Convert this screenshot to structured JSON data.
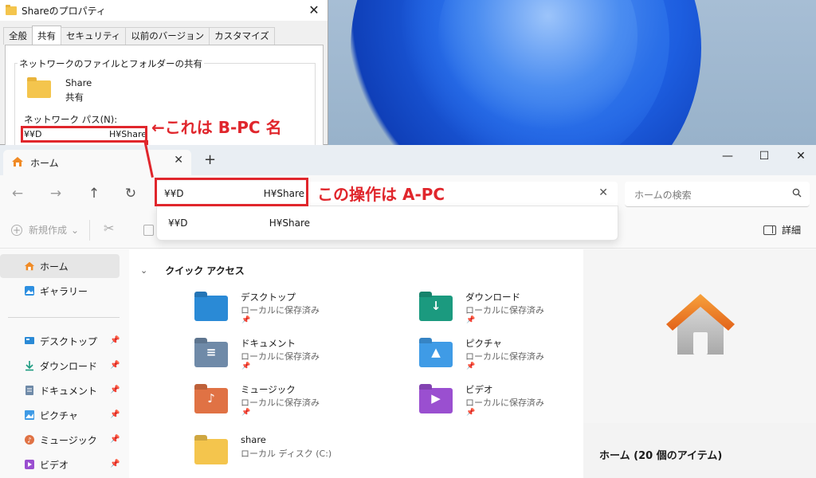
{
  "properties_dialog": {
    "title": "Shareのプロパティ",
    "close_glyph": "✕",
    "tabs": [
      "全般",
      "共有",
      "セキュリティ",
      "以前のバージョン",
      "カスタマイズ"
    ],
    "active_tab": 1,
    "group_label": "ネットワークのファイルとフォルダーの共有",
    "share_name": "Share",
    "share_state": "共有",
    "network_path_label": "ネットワーク パス(N):",
    "network_path_start": "¥¥D",
    "network_path_end": "H¥Share"
  },
  "annotations": {
    "b_pc": "←これは B-PC 名",
    "a_pc": "この操作は A-PC",
    "color": "#e0262c"
  },
  "explorer": {
    "tab_label": "ホーム",
    "tab_close": "✕",
    "new_tab": "+",
    "window_controls": [
      "—",
      "☐",
      "✕"
    ],
    "nav": {
      "back": "←",
      "forward": "→",
      "up": "↑",
      "refresh": "↻"
    },
    "address_start": "¥¥D",
    "address_end": "H¥Share",
    "address_clear": "✕",
    "suggestion_start": "¥¥D",
    "suggestion_end": "H¥Share",
    "search_placeholder": "ホームの検索",
    "toolbar": {
      "new_label": "新規作成",
      "new_chevron": "⌄",
      "detail_label": "詳細"
    },
    "sidebar": [
      {
        "label": "ホーム",
        "icon": "home-icon",
        "pinned": false
      },
      {
        "label": "ギャラリー",
        "icon": "gallery-icon",
        "pinned": false
      },
      {
        "label": "デスクトップ",
        "icon": "desktop-icon",
        "pinned": true
      },
      {
        "label": "ダウンロード",
        "icon": "download-icon",
        "pinned": true
      },
      {
        "label": "ドキュメント",
        "icon": "document-icon",
        "pinned": true
      },
      {
        "label": "ピクチャ",
        "icon": "picture-icon",
        "pinned": true
      },
      {
        "label": "ミュージック",
        "icon": "music-icon",
        "pinned": true
      },
      {
        "label": "ビデオ",
        "icon": "video-icon",
        "pinned": true
      }
    ],
    "quick_access_title": "クイック アクセス",
    "quick_access": [
      {
        "name": "デスクトップ",
        "sub": "ローカルに保存済み",
        "color": "#2a8ad6",
        "glyph": "",
        "icon": "desktop-folder-icon"
      },
      {
        "name": "ダウンロード",
        "sub": "ローカルに保存済み",
        "color": "#1b9a7f",
        "glyph": "↓",
        "icon": "download-folder-icon"
      },
      {
        "name": "ドキュメント",
        "sub": "ローカルに保存済み",
        "color": "#6f8aa8",
        "glyph": "≡",
        "icon": "document-folder-icon"
      },
      {
        "name": "ピクチャ",
        "sub": "ローカルに保存済み",
        "color": "#3f9be6",
        "glyph": "▲",
        "icon": "picture-folder-icon"
      },
      {
        "name": "ミュージック",
        "sub": "ローカルに保存済み",
        "color": "#e07244",
        "glyph": "♪",
        "icon": "music-folder-icon"
      },
      {
        "name": "ビデオ",
        "sub": "ローカルに保存済み",
        "color": "#9a4fd0",
        "glyph": "▶",
        "icon": "video-folder-icon"
      },
      {
        "name": "share",
        "sub": "ローカル ディスク (C:)",
        "color": "#f4c54d",
        "glyph": "",
        "icon": "share-folder-icon",
        "pinned": false
      }
    ],
    "pin_glyph": "📌",
    "detail_title": "ホーム (20 個のアイテム)"
  }
}
